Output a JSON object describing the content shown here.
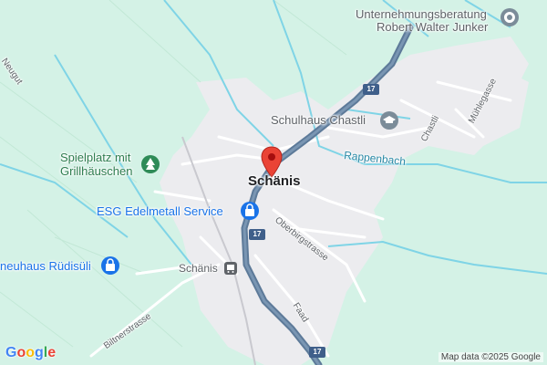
{
  "map": {
    "pois": {
      "unternehmung_line1": "Unternehmungsberatung",
      "unternehmung_line2": "Robert Walter Junker",
      "schulhaus": "Schulhaus Chastli",
      "spielplatz_line1": "Spielplatz mit",
      "spielplatz_line2": "Grillhäuschen",
      "esg": "ESG Edelmetall Service",
      "neuhaus": "neuhaus Rüdisüli",
      "station": "Schänis"
    },
    "town": "Schänis",
    "streets": {
      "neugut": "Neugut",
      "chastli": "Chastli",
      "muehlegasse": "Mühlegasse",
      "oberbirgstrasse": "Oberbirgstrasse",
      "faad": "Faad",
      "biltnerstrasse": "Biltnerstrasse"
    },
    "water": {
      "rappenbach": "Rappenbach"
    },
    "road_shields": {
      "a": "17",
      "b": "17",
      "c": "17"
    },
    "logo": {
      "g1": "G",
      "o1": "o",
      "o2": "o",
      "g2": "g",
      "l": "l",
      "e": "e"
    },
    "attribution": "Map data ©2025 Google",
    "colors": {
      "park": "#d4f2e6",
      "urban": "#ececef",
      "highway": "#5d7a99",
      "water": "#7fd4e6",
      "pin": "#ea4335"
    }
  }
}
